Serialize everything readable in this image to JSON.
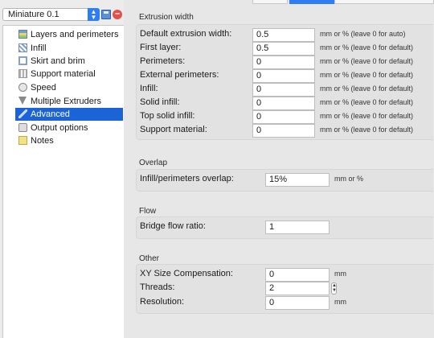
{
  "preset": {
    "value": "Miniature 0.1"
  },
  "tree": [
    {
      "label": "Layers and perimeters",
      "icon": "layers-icon"
    },
    {
      "label": "Infill",
      "icon": "infill-icon"
    },
    {
      "label": "Skirt and brim",
      "icon": "skirt-icon"
    },
    {
      "label": "Support material",
      "icon": "support-icon"
    },
    {
      "label": "Speed",
      "icon": "speed-icon"
    },
    {
      "label": "Multiple Extruders",
      "icon": "funnel-icon"
    },
    {
      "label": "Advanced",
      "icon": "wrench-icon",
      "selected": true
    },
    {
      "label": "Output options",
      "icon": "output-icon"
    },
    {
      "label": "Notes",
      "icon": "notes-icon"
    }
  ],
  "sections": {
    "extrusion_width": {
      "title": "Extrusion width",
      "rows": [
        {
          "label": "Default extrusion width:",
          "value": "0.5",
          "unit": "mm or % (leave 0 for auto)"
        },
        {
          "label": "First layer:",
          "value": "0.5",
          "unit": "mm or % (leave 0 for default)"
        },
        {
          "label": "Perimeters:",
          "value": "0",
          "unit": "mm or % (leave 0 for default)"
        },
        {
          "label": "External perimeters:",
          "value": "0",
          "unit": "mm or % (leave 0 for default)"
        },
        {
          "label": "Infill:",
          "value": "0",
          "unit": "mm or % (leave 0 for default)"
        },
        {
          "label": "Solid infill:",
          "value": "0",
          "unit": "mm or % (leave 0 for default)"
        },
        {
          "label": "Top solid infill:",
          "value": "0",
          "unit": "mm or % (leave 0 for default)"
        },
        {
          "label": "Support material:",
          "value": "0",
          "unit": "mm or % (leave 0 for default)"
        }
      ]
    },
    "overlap": {
      "title": "Overlap",
      "rows": [
        {
          "label": "Infill/perimeters overlap:",
          "value": "15%",
          "unit": "mm or %"
        }
      ]
    },
    "flow": {
      "title": "Flow",
      "rows": [
        {
          "label": "Bridge flow ratio:",
          "value": "1"
        }
      ]
    },
    "other": {
      "title": "Other",
      "rows": [
        {
          "label": "XY Size Compensation:",
          "value": "0",
          "unit": "mm"
        },
        {
          "label": "Threads:",
          "value": "2"
        },
        {
          "label": "Resolution:",
          "value": "0",
          "unit": "mm"
        }
      ]
    }
  },
  "colors": {
    "accent": "#2f7df6",
    "selection": "#1b64d8"
  }
}
